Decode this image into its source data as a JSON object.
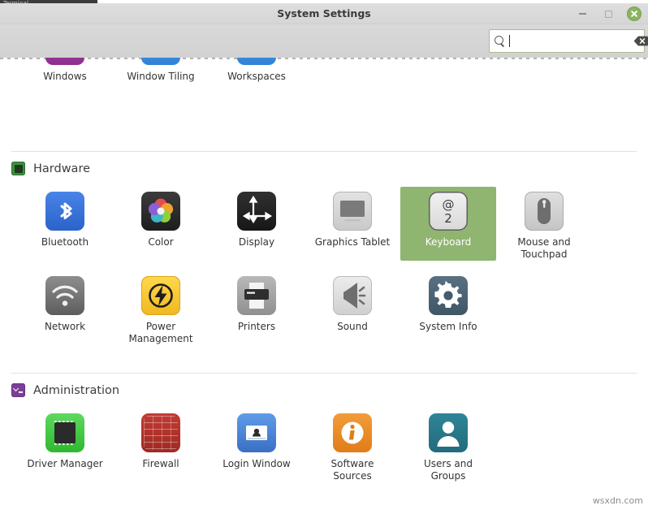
{
  "window": {
    "title": "System Settings",
    "behind_window_title": "Terminal",
    "controls": {
      "minimize_label": "Minimize",
      "maximize_label": "Restore",
      "close_label": "Close"
    }
  },
  "toolbar": {
    "search": {
      "value": "",
      "placeholder": "",
      "search_icon": "search-icon",
      "clear_icon": "clear-backspace-icon"
    }
  },
  "content": {
    "partial_row": {
      "items": [
        {
          "label": "Windows",
          "icon": "windows-icon",
          "color": "#993399"
        },
        {
          "label": "Window Tiling",
          "icon": "window-tiling-icon",
          "color": "#3a93e0"
        },
        {
          "label": "Workspaces",
          "icon": "workspaces-icon",
          "color": "#3a93e0"
        }
      ]
    },
    "sections": [
      {
        "id": "hardware",
        "title": "Hardware",
        "icon": "chip-icon",
        "icon_color": "#3e8e3f",
        "rows": [
          [
            {
              "label": "Bluetooth",
              "icon": "bluetooth-icon",
              "selected": false
            },
            {
              "label": "Color",
              "icon": "color-icon",
              "selected": false
            },
            {
              "label": "Display",
              "icon": "display-icon",
              "selected": false
            },
            {
              "label": "Graphics Tablet",
              "icon": "graphics-tablet-icon",
              "selected": false
            },
            {
              "label": "Keyboard",
              "icon": "keyboard-icon",
              "selected": true
            },
            {
              "label": "Mouse and\nTouchpad",
              "icon": "mouse-touchpad-icon",
              "selected": false
            }
          ],
          [
            {
              "label": "Network",
              "icon": "network-icon",
              "selected": false
            },
            {
              "label": "Power\nManagement",
              "icon": "power-management-icon",
              "selected": false
            },
            {
              "label": "Printers",
              "icon": "printers-icon",
              "selected": false
            },
            {
              "label": "Sound",
              "icon": "sound-icon",
              "selected": false
            },
            {
              "label": "System Info",
              "icon": "system-info-icon",
              "selected": false
            }
          ]
        ]
      },
      {
        "id": "administration",
        "title": "Administration",
        "icon": "terminal-icon",
        "icon_color": "#7b3f98",
        "rows": [
          [
            {
              "label": "Driver Manager",
              "icon": "driver-manager-icon",
              "selected": false
            },
            {
              "label": "Firewall",
              "icon": "firewall-icon",
              "selected": false
            },
            {
              "label": "Login Window",
              "icon": "login-window-icon",
              "selected": false
            },
            {
              "label": "Software\nSources",
              "icon": "software-sources-icon",
              "selected": false
            },
            {
              "label": "Users and\nGroups",
              "icon": "users-groups-icon",
              "selected": false
            }
          ]
        ]
      }
    ]
  },
  "watermark": "wsxdn.com",
  "colors": {
    "selection": "#8fb570",
    "titlebar": "#d9d9d9",
    "close_button": "#8ab45f",
    "search_border": "#a7bd8e"
  }
}
